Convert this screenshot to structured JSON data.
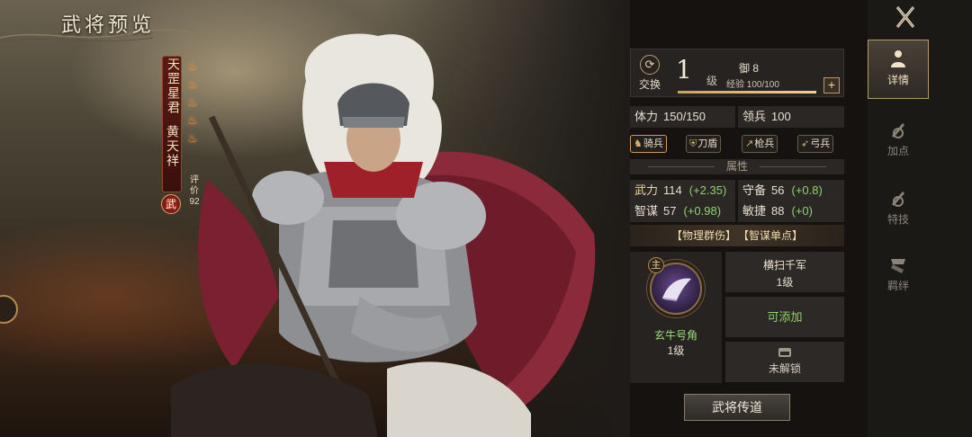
{
  "screen": {
    "title": "武将预览"
  },
  "hero": {
    "epithet": "天罡星君",
    "name": "黄天祥",
    "rating_label": "评价",
    "rating_value": "92",
    "role": "武",
    "stars": 5
  },
  "level_card": {
    "swap_label": "交换",
    "level": "1",
    "level_unit": "级",
    "rank": "御 8",
    "exp_text": "经验 100/100",
    "exp_fraction": 1.0
  },
  "stats": {
    "hp_label": "体力",
    "hp_value": "150/150",
    "troops_label": "领兵",
    "troops_value": "100",
    "section_label": "属性",
    "rows": [
      {
        "l1": "武力",
        "v1": "114",
        "b1": "(+2.35)",
        "l2": "守备",
        "v2": "56",
        "b2": "(+0.8)"
      },
      {
        "l1": "智谋",
        "v1": "57",
        "b1": "(+0.98)",
        "l2": "敏捷",
        "v2": "88",
        "b2": "(+0)"
      }
    ]
  },
  "units": [
    "骑兵",
    "刀盾",
    "枪兵",
    "弓兵"
  ],
  "tags": [
    "【物理群伤】",
    "【智谋单点】"
  ],
  "skill_main": {
    "tag": "主",
    "name": "玄牛号角",
    "level": "1级"
  },
  "slots": {
    "slot1_name": "横扫千军",
    "slot1_level": "1级",
    "slot2_text": "可添加",
    "slot3_text": "未解锁"
  },
  "transmit_label": "武将传道",
  "tabs": [
    {
      "label": "详情",
      "active": true
    },
    {
      "label": "加点",
      "active": false
    },
    {
      "label": "特技",
      "active": false
    },
    {
      "label": "羁绊",
      "active": false
    }
  ],
  "colors": {
    "bonus_green": "#8fd36a",
    "accent_gold": "#c9a45e",
    "skill_purple": "#6a4a8e"
  }
}
